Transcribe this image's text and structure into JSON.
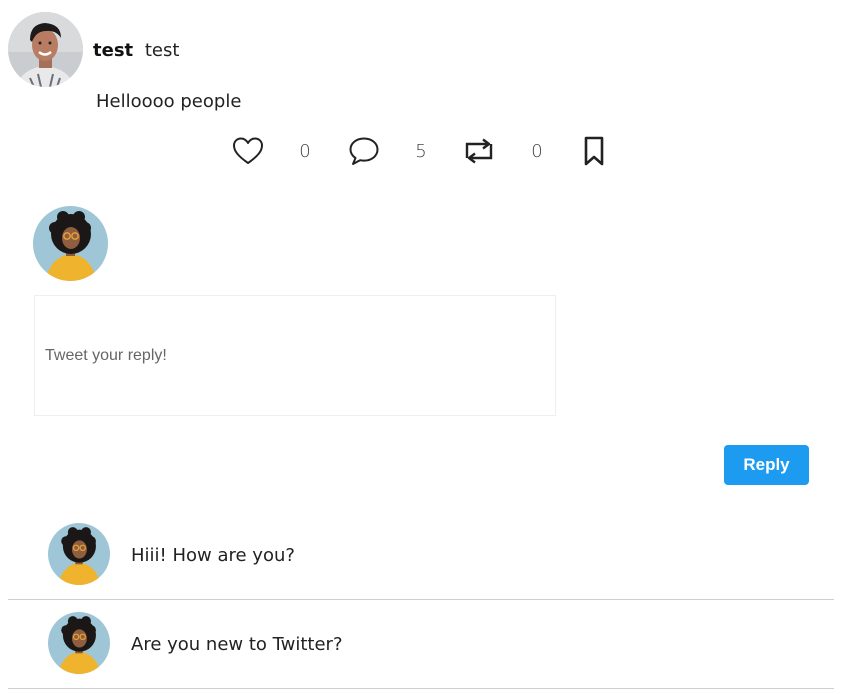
{
  "tweet": {
    "author_name": "test",
    "author_handle": "test",
    "text": "Helloooo people",
    "author_avatar_icon": "man-portrait-avatar"
  },
  "actions": {
    "like": {
      "icon": "heart-icon",
      "count": "0"
    },
    "comment": {
      "icon": "comment-bubble-icon",
      "count": "5"
    },
    "retweet": {
      "icon": "retweet-icon",
      "count": "0"
    },
    "bookmark": {
      "icon": "bookmark-icon"
    }
  },
  "composer": {
    "avatar_icon": "woman-portrait-avatar",
    "placeholder": "Tweet your reply!",
    "value": "",
    "reply_label": "Reply"
  },
  "replies": [
    {
      "text": "Hiii! How are you?",
      "avatar_icon": "woman-portrait-avatar"
    },
    {
      "text": "Are you new to Twitter?",
      "avatar_icon": "woman-portrait-avatar"
    }
  ],
  "colors": {
    "accent": "#1d9bf0",
    "divider": "#cfcfcf",
    "text": "#222222"
  }
}
